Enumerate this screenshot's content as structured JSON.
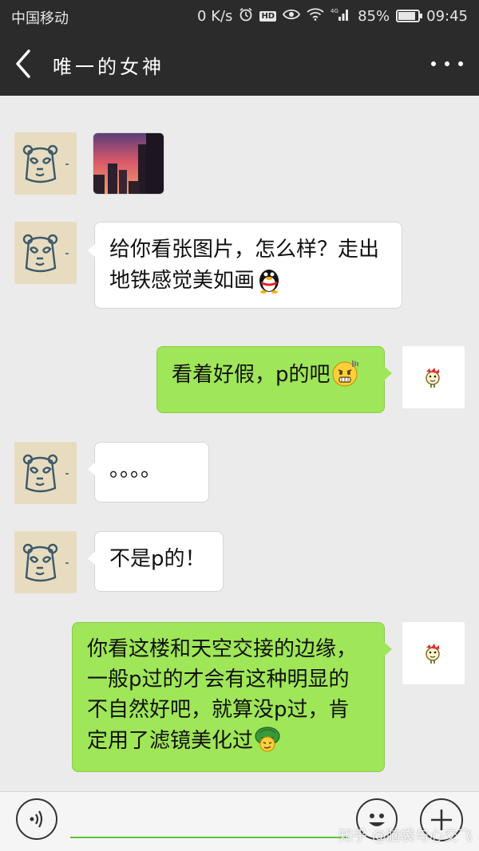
{
  "status_bar": {
    "carrier": "中国移动",
    "net_speed": "0 K/s",
    "hd_badge": "HD",
    "network_type": "4G",
    "battery": "85%",
    "battery_level": 0.85,
    "time": "09:45",
    "icons": [
      "alarm-icon",
      "eye-icon",
      "wifi-icon",
      "signal-icon",
      "battery-icon"
    ]
  },
  "header": {
    "title": "唯一的女神",
    "back_icon": "chevron-left-icon",
    "menu_icon": "more-dots-icon"
  },
  "colors": {
    "header_bg": "#2b2b2b",
    "chat_bg": "#ebebeb",
    "bubble_in": "#ffffff",
    "bubble_out": "#9fe658",
    "input_underline": "#5fbf3a"
  },
  "messages": [
    {
      "from": "contact",
      "type": "image",
      "image": "city-sunset-photo"
    },
    {
      "from": "contact",
      "type": "text",
      "lines": [
        "给你看张图片，怎么样？走出",
        "地铁感觉美如画"
      ],
      "emoji": "penguin-emoji"
    },
    {
      "from": "self",
      "type": "text",
      "lines": [
        "看着好假，p的吧"
      ],
      "emoji": "grimace-emoji"
    },
    {
      "from": "contact",
      "type": "text",
      "lines": [
        "。。。。"
      ]
    },
    {
      "from": "contact",
      "type": "text",
      "lines": [
        "不是p的！"
      ]
    },
    {
      "from": "self",
      "type": "text",
      "lines": [
        "你看这楼和天空交接的边缘，",
        "一般p过的才会有这种明显的",
        "不自然好吧，就算没p过，肯",
        "定用了滤镜美化过"
      ],
      "emoji": "turtle-emoji"
    }
  ],
  "input_bar": {
    "voice_icon": "voice-icon",
    "emoji_icon": "smiley-icon",
    "plus_icon": "plus-icon",
    "input_value": ""
  },
  "watermark": "知乎 @脑袋与心交飞"
}
